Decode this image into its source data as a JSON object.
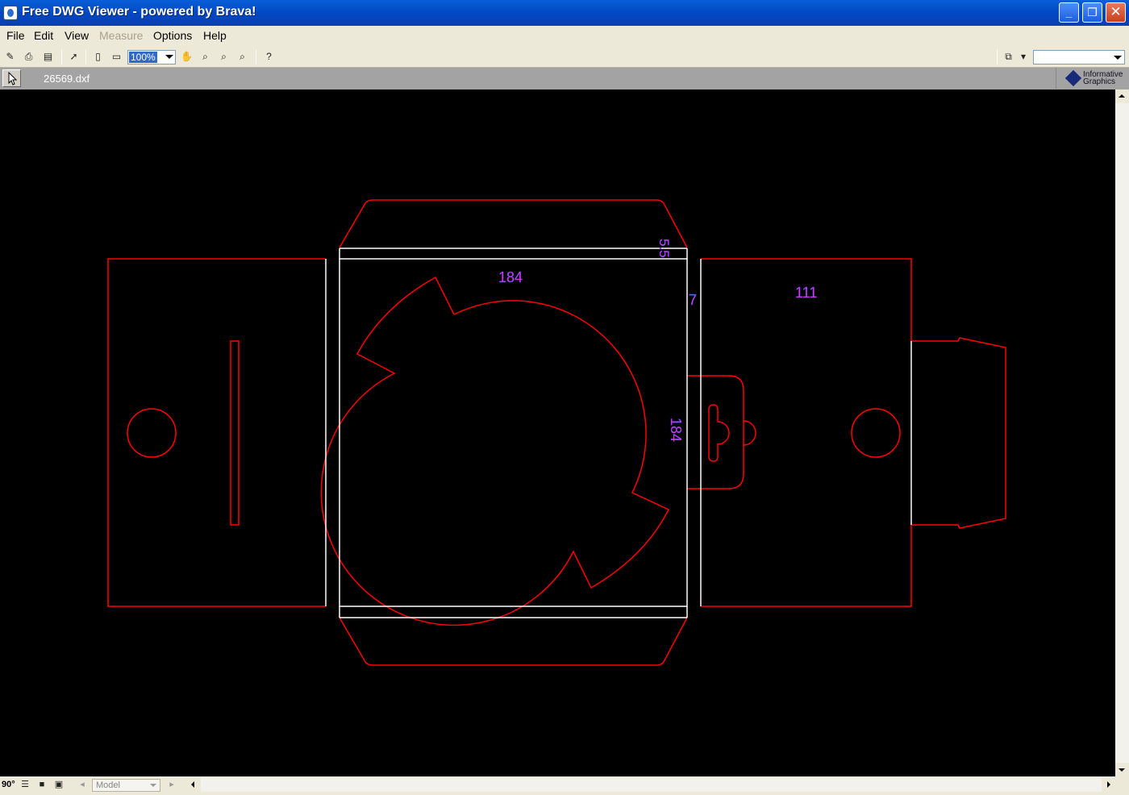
{
  "window": {
    "title": "Free DWG Viewer - powered by Brava!",
    "minimize_icon": "minimize-icon",
    "maximize_icon": "maximize-icon",
    "close_icon": "close-icon"
  },
  "menu": {
    "file": "File",
    "edit": "Edit",
    "view": "View",
    "measure": "Measure",
    "options": "Options",
    "help": "Help"
  },
  "toolbar": {
    "zoom_value": "100%",
    "right_combo_value": ""
  },
  "tabbar": {
    "filename": "26569.dxf",
    "brand_line1": "Informative",
    "brand_line2": "Graphics"
  },
  "drawing": {
    "background": "#000000",
    "cut_line_color": "#ff0000",
    "fold_line_color": "#ffffff",
    "dimension_color": "#ff33cc",
    "dim_184_top": "184",
    "dim_55": "5.5",
    "dim_7": "7",
    "dim_111": "111",
    "dim_184_side": "184"
  },
  "bottombar": {
    "rotation": "90°",
    "layout_value": "Model"
  }
}
